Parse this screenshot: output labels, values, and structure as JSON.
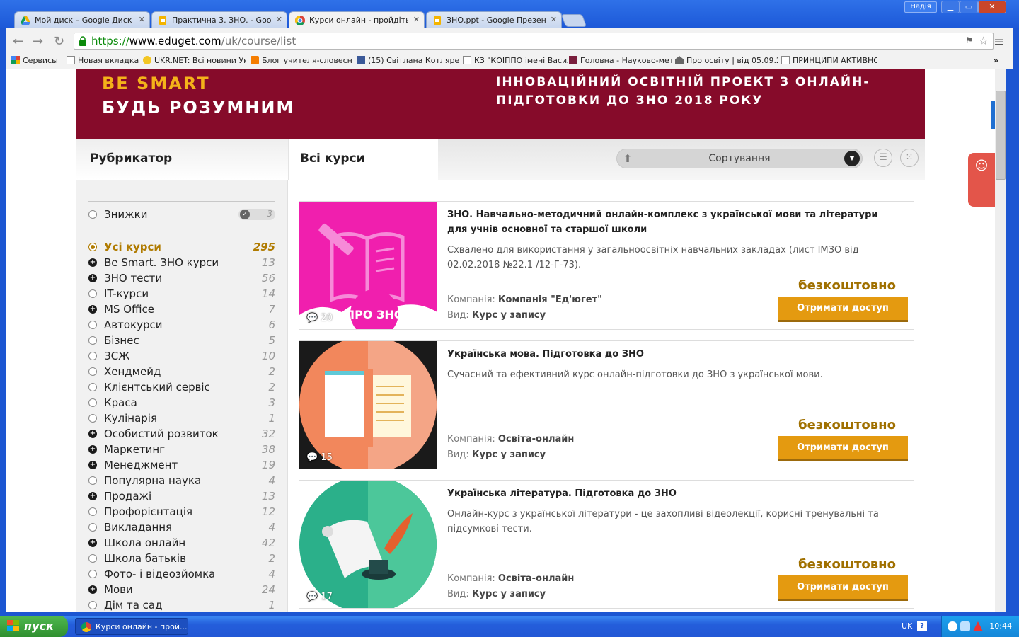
{
  "browser": {
    "tabs": [
      {
        "label": "Мой диск – Google Диск",
        "icon": "google-drive-icon"
      },
      {
        "label": "Практична 3. ЗНО. - Google",
        "icon": "google-slides-icon"
      },
      {
        "label": "Курси онлайн - пройдіть ку",
        "icon": "chrome-icon",
        "active": true
      },
      {
        "label": "ЗНО.ppt - Google Презентац",
        "icon": "google-slides-icon"
      }
    ],
    "user": "Надія",
    "url": {
      "scheme": "https://",
      "host": "www.eduget.com",
      "path": "/uk/course/list"
    },
    "bookmarks": [
      {
        "label": "Сервисы"
      },
      {
        "label": "Новая вкладка"
      },
      {
        "label": "UKR.NET: Всі новини Ук"
      },
      {
        "label": "Блог учителя-словесн"
      },
      {
        "label": "(15) Світлана Котляре"
      },
      {
        "label": "КЗ \"КОІППО імені Васил"
      },
      {
        "label": "Головна - Науково-мет"
      },
      {
        "label": "Про освіту | від 05.09.2"
      },
      {
        "label": "ПРИНЦИПИ АКТИВНОГО"
      }
    ],
    "more_bookmarks": "»"
  },
  "banner": {
    "be_smart": "BE SMART",
    "tagline": "БУДЬ РОЗУМНИМ",
    "project_line1": "ІННОВАЦІЙНИЙ ОСВІТНІЙ ПРОЕКТ З ОНЛАЙН-",
    "project_line2": "ПІДГОТОВКИ ДО ЗНО 2018 РОКУ"
  },
  "catalog": {
    "rubricator": "Рубрикатор",
    "all_courses": "Всі курси",
    "sort_label": "Сортування",
    "discounts": {
      "label": "Знижки",
      "count": "3"
    },
    "categories": [
      {
        "label": "Усі курси",
        "count": "295",
        "type": "selected"
      },
      {
        "label": "Be Smart. ЗНО курси",
        "count": "13",
        "type": "plus"
      },
      {
        "label": "ЗНО тести",
        "count": "56",
        "type": "plus"
      },
      {
        "label": "IT-курси",
        "count": "14",
        "type": "radio"
      },
      {
        "label": "MS Office",
        "count": "7",
        "type": "plus"
      },
      {
        "label": "Автокурси",
        "count": "6",
        "type": "radio"
      },
      {
        "label": "Бізнес",
        "count": "5",
        "type": "radio"
      },
      {
        "label": "ЗСЖ",
        "count": "10",
        "type": "radio"
      },
      {
        "label": "Хендмейд",
        "count": "2",
        "type": "radio"
      },
      {
        "label": "Клієнтський сервіс",
        "count": "2",
        "type": "radio"
      },
      {
        "label": "Краса",
        "count": "3",
        "type": "radio"
      },
      {
        "label": "Кулінарія",
        "count": "1",
        "type": "radio"
      },
      {
        "label": "Особистий розвиток",
        "count": "32",
        "type": "plus"
      },
      {
        "label": "Маркетинг",
        "count": "38",
        "type": "plus"
      },
      {
        "label": "Менеджмент",
        "count": "19",
        "type": "plus"
      },
      {
        "label": "Популярна наука",
        "count": "4",
        "type": "radio"
      },
      {
        "label": "Продажі",
        "count": "13",
        "type": "plus"
      },
      {
        "label": "Профорієнтація",
        "count": "12",
        "type": "radio"
      },
      {
        "label": "Викладання",
        "count": "4",
        "type": "radio"
      },
      {
        "label": "Школа онлайн",
        "count": "42",
        "type": "plus"
      },
      {
        "label": "Школа батьків",
        "count": "2",
        "type": "radio"
      },
      {
        "label": "Фото- і відеозйомка",
        "count": "4",
        "type": "radio"
      },
      {
        "label": "Мови",
        "count": "24",
        "type": "plus"
      },
      {
        "label": "Дім та сад",
        "count": "1",
        "type": "radio"
      }
    ]
  },
  "courses": [
    {
      "title": "ЗНО. Навчально-методичний онлайн-комплекс з української мови та літератури для учнів основної та старшої школи",
      "desc": "Схвалено для використання у загальноосвітніх навчальних закладах (лист ІМЗО від 02.02.2018 №22.1 /12-Г-73).",
      "price": "безкоштовно",
      "button": "Отримати доступ",
      "company_label": "Компанія: ",
      "company": "Компанія \"Ед'югет\"",
      "type_label": "Вид: ",
      "type": "Курс у запису",
      "comments": "20",
      "thumb_text": "ПРО ЗНО"
    },
    {
      "title": "Українська мова. Підготовка до ЗНО",
      "desc": "Сучасний та ефективний курс онлайн-підготовки до ЗНО з української мови.",
      "price": "безкоштовно",
      "button": "Отримати доступ",
      "company_label": "Компанія: ",
      "company": "Освіта-онлайн",
      "type_label": "Вид: ",
      "type": "Курс у запису",
      "comments": "15"
    },
    {
      "title": "Українська література. Підготовка до ЗНО",
      "desc": "Онлайн-курс з української літератури - це захопливі відеолекції, корисні тренувальні та підсумкові тести.",
      "price": "безкоштовно",
      "button": "Отримати доступ",
      "company_label": "Компанія: ",
      "company": "Освіта-онлайн",
      "type_label": "Вид: ",
      "type": "Курс у запису",
      "comments": "17"
    }
  ],
  "taskbar": {
    "start": "пуск",
    "task": "Курси онлайн - прой...",
    "lang": "UK",
    "clock": "10:44"
  }
}
